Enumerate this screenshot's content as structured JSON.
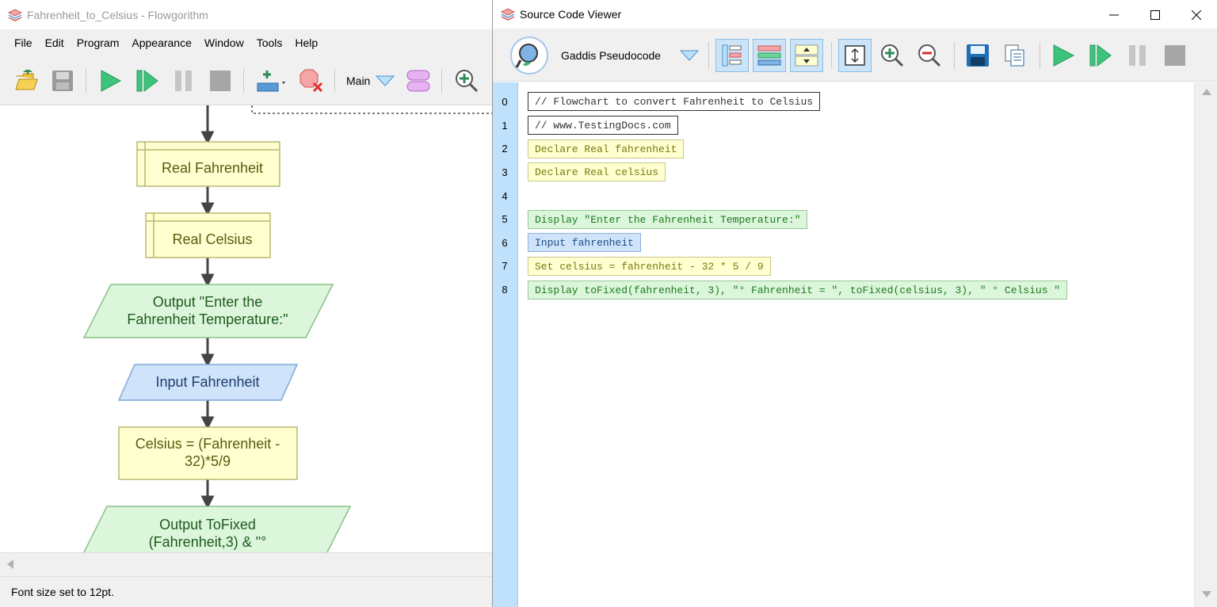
{
  "main_window": {
    "title": "Fahrenheit_to_Celsius - Flowgorithm",
    "menu": [
      "File",
      "Edit",
      "Program",
      "Appearance",
      "Window",
      "Tools",
      "Help"
    ],
    "toolbar": {
      "function_select": "Main",
      "icons": [
        "open-folder-icon",
        "save-icon",
        "run-icon",
        "step-icon",
        "pause-icon",
        "stop-icon",
        "add-variable-watch-icon",
        "breakpoint-remove-icon",
        "functions-icon",
        "zoom-in-icon"
      ]
    },
    "flowchart": {
      "shapes": [
        {
          "kind": "declare",
          "text": "Real Fahrenheit"
        },
        {
          "kind": "declare",
          "text": "Real Celsius"
        },
        {
          "kind": "output",
          "lines": [
            "Output \"Enter the",
            "Fahrenheit Temperature:\""
          ]
        },
        {
          "kind": "input",
          "text": "Input Fahrenheit"
        },
        {
          "kind": "assign",
          "lines": [
            "Celsius = (Fahrenheit -",
            "32)*5/9"
          ]
        },
        {
          "kind": "output",
          "lines": [
            "Output ToFixed",
            "(Fahrenheit,3) & \"°"
          ]
        }
      ]
    },
    "status": "Font size set to 12pt."
  },
  "code_window": {
    "title": "Source Code Viewer",
    "language": "Gaddis Pseudocode",
    "lines": [
      {
        "num": "0",
        "text": "// Flowchart to convert Fahrenheit to Celsius",
        "kind": "comment"
      },
      {
        "num": "1",
        "text": "// www.TestingDocs.com",
        "kind": "comment"
      },
      {
        "num": "2",
        "text": "Declare Real fahrenheit",
        "kind": "declare"
      },
      {
        "num": "3",
        "text": "Declare Real celsius",
        "kind": "declare"
      },
      {
        "num": "4",
        "text": "",
        "kind": "blank"
      },
      {
        "num": "5",
        "text": "Display \"Enter the Fahrenheit Temperature:\"",
        "kind": "output"
      },
      {
        "num": "6",
        "text": "Input fahrenheit",
        "kind": "input"
      },
      {
        "num": "7",
        "text": "Set celsius = fahrenheit - 32 * 5 / 9",
        "kind": "assign"
      },
      {
        "num": "8",
        "text": "Display toFixed(fahrenheit, 3), \"° Fahrenheit = \", toFixed(celsius, 3), \" ° Celsius \"",
        "kind": "output"
      }
    ]
  },
  "colors": {
    "declare_fill": "#ffffd0",
    "output_fill": "#dcf6dc",
    "input_fill": "#cfe3fb",
    "gutter": "#bfe1fb"
  }
}
